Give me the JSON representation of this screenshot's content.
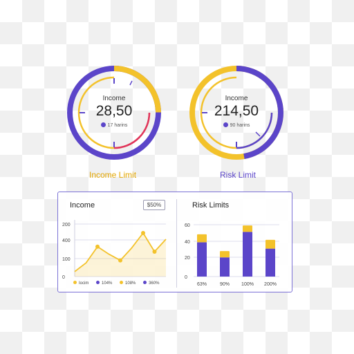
{
  "colors": {
    "yellow": "#f3c22b",
    "purple": "#5b45c9",
    "red": "#e0325f"
  },
  "gauge_left": {
    "label": "Income",
    "value": "28,50",
    "sub": "17 harins",
    "title": "Income Limit",
    "title_color": "#e3a600",
    "sub_dot_color": "#5b45c9"
  },
  "gauge_right": {
    "label": "Income",
    "value": "214,50",
    "sub": "90 harins",
    "title": "Risk Limit",
    "title_color": "#5b45c9",
    "sub_dot_color": "#5b45c9"
  },
  "panel": {
    "income_title": "Income",
    "badge": "$50%",
    "risk_title": "Risk Limits"
  },
  "chart_data": [
    {
      "type": "area",
      "title": "Income",
      "ylim": [
        0,
        250
      ],
      "yticks": [
        "200",
        "400",
        "100",
        "0"
      ],
      "x": [
        0,
        1,
        2,
        3,
        4,
        5,
        6,
        7,
        8
      ],
      "values": [
        20,
        55,
        120,
        90,
        65,
        115,
        175,
        100,
        150
      ],
      "line_color": "#f3c22b",
      "legend": [
        {
          "label": "Iocim",
          "color": "#f3c22b"
        },
        {
          "label": "104%",
          "color": "#5b45c9"
        },
        {
          "label": "108%",
          "color": "#f3c22b"
        },
        {
          "label": "360%",
          "color": "#5b45c9"
        }
      ]
    },
    {
      "type": "bar",
      "title": "Risk Limits",
      "categories": [
        "63%",
        "90%",
        "100%",
        "200%"
      ],
      "ylim": [
        0,
        65
      ],
      "yticks": [
        "60",
        "40",
        "20",
        "0"
      ],
      "series": [
        {
          "values": [
            43,
            24,
            56,
            35
          ]
        },
        {
          "values": [
            10,
            8,
            8,
            11
          ]
        }
      ],
      "series_colors": [
        "#5b45c9",
        "#f3c22b"
      ]
    }
  ]
}
